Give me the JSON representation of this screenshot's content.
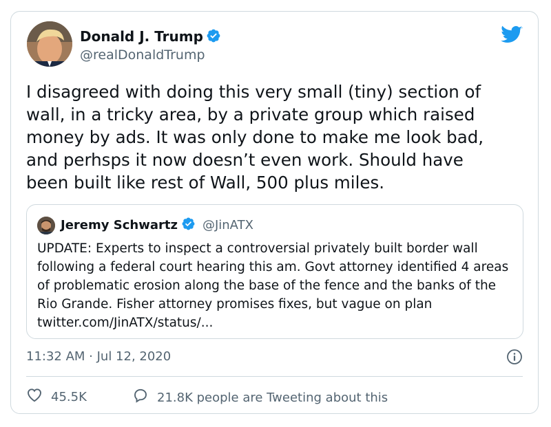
{
  "author": {
    "name": "Donald J. Trump",
    "handle": "@realDonaldTrump",
    "verified": true,
    "avatar": "profile-photo"
  },
  "tweet": {
    "text": "I disagreed with doing this very small (tiny) section of\nwall, in a tricky area, by a private group which raised\nmoney by ads. It was only done to make me look bad,\nand perhsps it now doesn’t even work. Should have\nbeen built like rest of Wall, 500 plus miles."
  },
  "quoted_tweet": {
    "name": "Jeremy Schwartz",
    "handle": "@JinATX",
    "verified": true,
    "text": "UPDATE: Experts to inspect a controversial privately built border wall following a federal court hearing this am. Govt attorney identified 4 areas of problematic erosion along the base of the fence and the banks of the Rio Grande. Fisher attorney promises fixes, but vague on plan twitter.com/JinATX/status/..."
  },
  "meta": {
    "timestamp": "11:32 AM · Jul 12, 2020"
  },
  "actions": {
    "likes": "45.5K",
    "conversation": "21.8K people are Tweeting about this"
  },
  "icons": {
    "brand": "twitter-bird-icon",
    "verified": "verified-badge-icon",
    "info": "info-icon",
    "like": "heart-icon",
    "reply": "speech-bubble-icon"
  },
  "colors": {
    "brand_blue": "#1d9bf0",
    "text": "#0f1419",
    "secondary": "#536471",
    "border": "#cfd9de"
  }
}
